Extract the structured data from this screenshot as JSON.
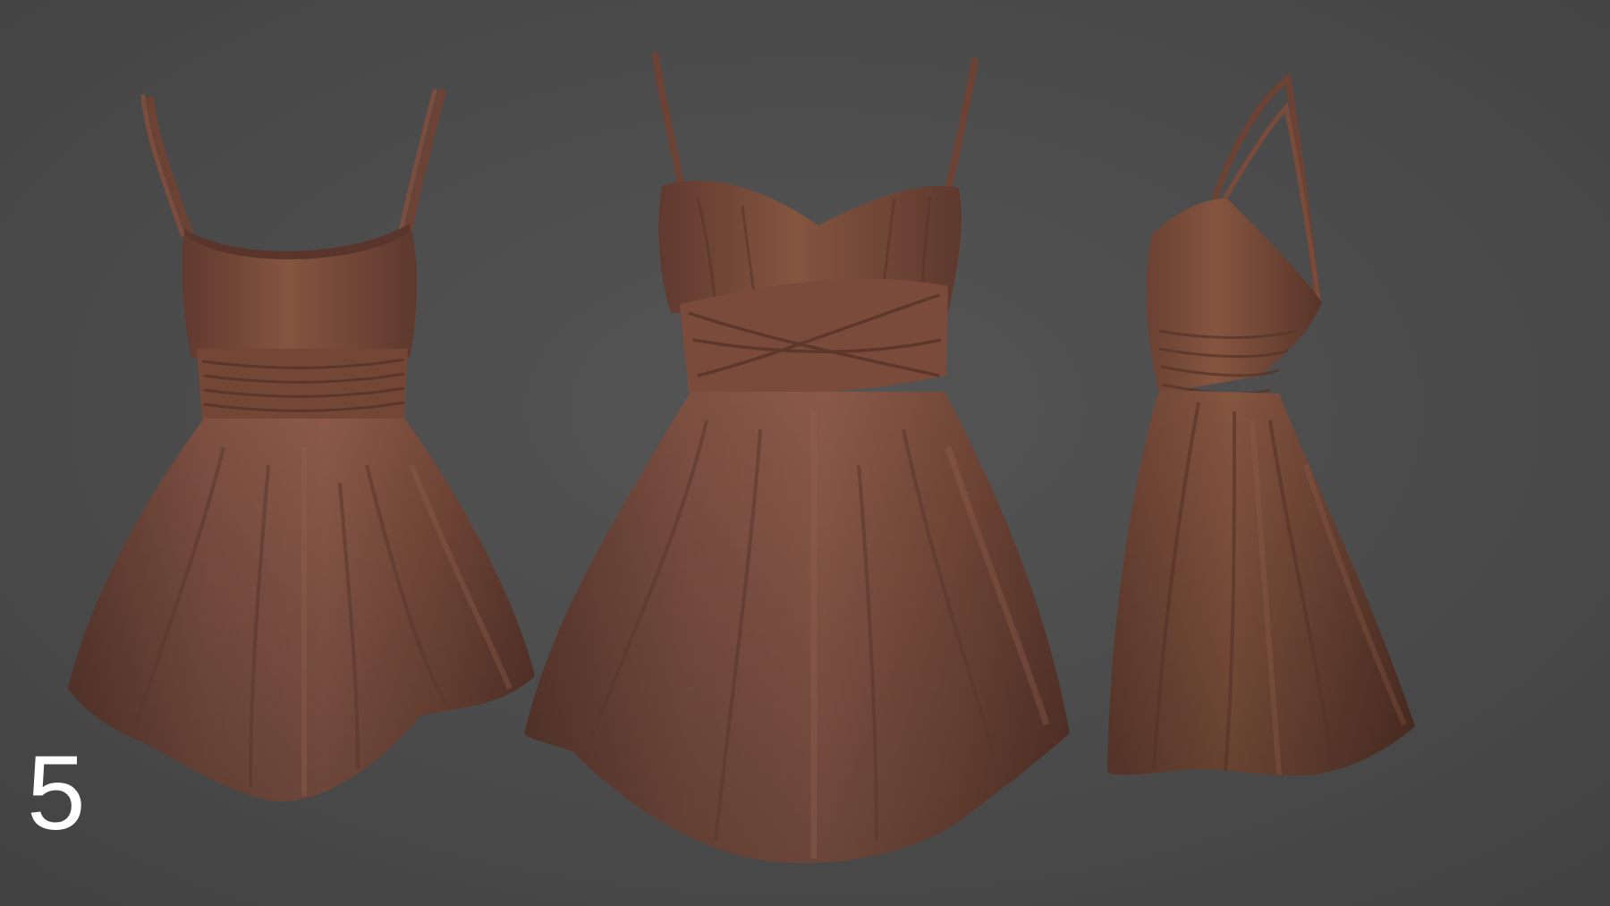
{
  "scene": {
    "background_color": "#4a4a4a",
    "fabric_color": "#7a4c3e",
    "subject": "dress",
    "views": [
      {
        "name": "back-view"
      },
      {
        "name": "front-view"
      },
      {
        "name": "side-view"
      }
    ]
  },
  "label": {
    "number": "5",
    "color": "#ffffff"
  }
}
